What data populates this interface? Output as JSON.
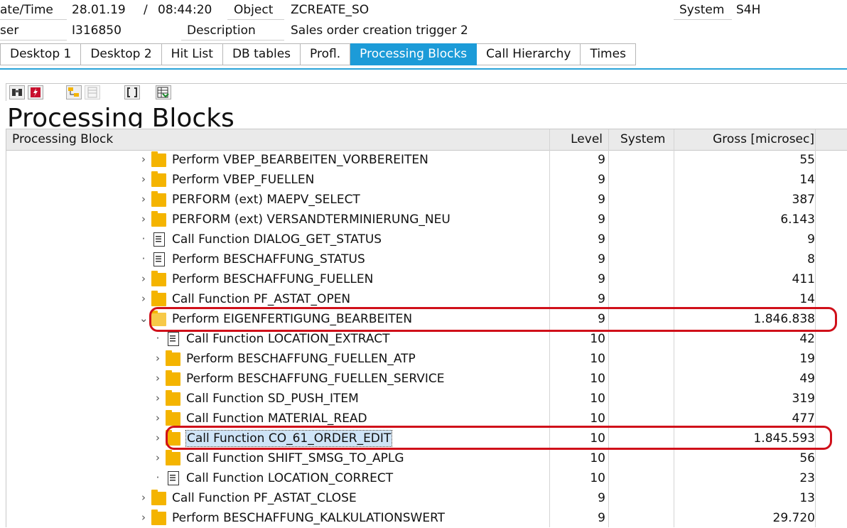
{
  "header": {
    "date_label": "ate/Time",
    "date_value": "28.01.19",
    "time_sep": "/",
    "time_value": "08:44:20",
    "object_label": "Object",
    "object_value": "ZCREATE_SO",
    "system_label": "System",
    "system_value": "S4H",
    "user_label": "ser",
    "user_value": "I316850",
    "description_label": "Description",
    "description_value": "Sales order creation trigger 2"
  },
  "tabs": [
    {
      "label": "Desktop 1",
      "active": false
    },
    {
      "label": "Desktop 2",
      "active": false
    },
    {
      "label": "Hit List",
      "active": false
    },
    {
      "label": "DB tables",
      "active": false
    },
    {
      "label": "Profl.",
      "active": false
    },
    {
      "label": "Processing Blocks",
      "active": true
    },
    {
      "label": "Call Hierarchy",
      "active": false
    },
    {
      "label": "Times",
      "active": false
    }
  ],
  "toolbar_icons": [
    "binoculars-icon",
    "lightning-icon",
    "expand-tree-icon",
    "collapse-tree-icon",
    "bracket-icon",
    "spreadsheet-export-icon"
  ],
  "section_title": "Processing Blocks",
  "columns": {
    "block": "Processing Block",
    "level": "Level",
    "system": "System",
    "gross": "Gross [microsec]"
  },
  "colors": {
    "active_tab": "#1c9bd8",
    "highlight": "#d0101a",
    "folder": "#f4b400"
  },
  "rows": [
    {
      "label": "Perform VBEP_BEARBEITEN_VORBEREITEN",
      "level": "9",
      "gross": "55",
      "indent": 0,
      "icon": "folder-icon",
      "exp": "›"
    },
    {
      "label": "Perform VBEP_FUELLEN",
      "level": "9",
      "gross": "14",
      "indent": 0,
      "icon": "folder-icon",
      "exp": "›"
    },
    {
      "label": "PERFORM (ext) MAEPV_SELECT",
      "level": "9",
      "gross": "387",
      "indent": 0,
      "icon": "folder-icon",
      "exp": "›"
    },
    {
      "label": "PERFORM (ext) VERSANDTERMINIERUNG_NEU",
      "level": "9",
      "gross": "6.143",
      "indent": 0,
      "icon": "folder-icon",
      "exp": "›"
    },
    {
      "label": "Call Function DIALOG_GET_STATUS",
      "level": "9",
      "gross": "9",
      "indent": 0,
      "icon": "document-icon",
      "exp": "·"
    },
    {
      "label": "Perform BESCHAFFUNG_STATUS",
      "level": "9",
      "gross": "8",
      "indent": 0,
      "icon": "document-icon",
      "exp": "·"
    },
    {
      "label": "Perform BESCHAFFUNG_FUELLEN",
      "level": "9",
      "gross": "411",
      "indent": 0,
      "icon": "folder-icon",
      "exp": "›"
    },
    {
      "label": "Call Function PF_ASTAT_OPEN",
      "level": "9",
      "gross": "14",
      "indent": 0,
      "icon": "folder-icon",
      "exp": "›"
    },
    {
      "label": "Perform EIGENFERTIGUNG_BEARBEITEN",
      "level": "9",
      "gross": "1.846.838",
      "indent": 0,
      "icon": "open-folder-icon",
      "exp": "⌄"
    },
    {
      "label": "Call Function LOCATION_EXTRACT",
      "level": "10",
      "gross": "42",
      "indent": 1,
      "icon": "document-icon",
      "exp": "·"
    },
    {
      "label": "Perform BESCHAFFUNG_FUELLEN_ATP",
      "level": "10",
      "gross": "19",
      "indent": 1,
      "icon": "folder-icon",
      "exp": "›"
    },
    {
      "label": "Perform BESCHAFFUNG_FUELLEN_SERVICE",
      "level": "10",
      "gross": "49",
      "indent": 1,
      "icon": "folder-icon",
      "exp": "›"
    },
    {
      "label": "Call Function SD_PUSH_ITEM",
      "level": "10",
      "gross": "319",
      "indent": 1,
      "icon": "folder-icon",
      "exp": "›"
    },
    {
      "label": "Call Function MATERIAL_READ",
      "level": "10",
      "gross": "477",
      "indent": 1,
      "icon": "folder-icon",
      "exp": "›"
    },
    {
      "label": "Call Function CO_61_ORDER_EDIT",
      "level": "10",
      "gross": "1.845.593",
      "indent": 1,
      "icon": "folder-icon",
      "exp": "›"
    },
    {
      "label": "Call Function SHIFT_SMSG_TO_APLG",
      "level": "10",
      "gross": "56",
      "indent": 1,
      "icon": "folder-icon",
      "exp": "›"
    },
    {
      "label": "Call Function LOCATION_CORRECT",
      "level": "10",
      "gross": "23",
      "indent": 1,
      "icon": "document-icon",
      "exp": "·"
    },
    {
      "label": "Call Function PF_ASTAT_CLOSE",
      "level": "9",
      "gross": "13",
      "indent": 0,
      "icon": "folder-icon",
      "exp": "›"
    },
    {
      "label": "Perform BESCHAFFUNG_KALKULATIONSWERT",
      "level": "9",
      "gross": "29.720",
      "indent": 0,
      "icon": "folder-icon",
      "exp": "›"
    }
  ],
  "selected_row": 14,
  "highlighted_rows": [
    8,
    14
  ]
}
